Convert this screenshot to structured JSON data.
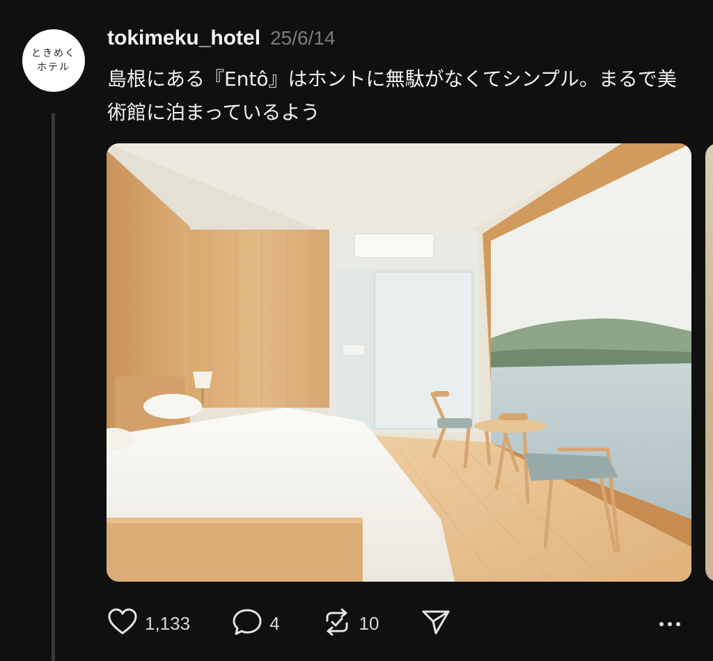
{
  "author": {
    "avatar_line1": "ときめく",
    "avatar_line2": "ホテル",
    "username": "tokimeku_hotel",
    "timestamp": "25/6/14"
  },
  "post": {
    "text": "島根にある『Entô』はホントに無駄がなくてシンプル。まるで美術館に泊まっているよう"
  },
  "actions": {
    "like_count": "1,133",
    "reply_count": "4",
    "repost_count": "10"
  },
  "icons": {
    "like": "heart-icon",
    "reply": "speech-bubble-icon",
    "repost": "repost-icon",
    "share": "send-icon",
    "more": "more-icon"
  },
  "colors": {
    "background": "#101010",
    "text": "#f2f2f2",
    "muted": "#7d7d7d"
  }
}
